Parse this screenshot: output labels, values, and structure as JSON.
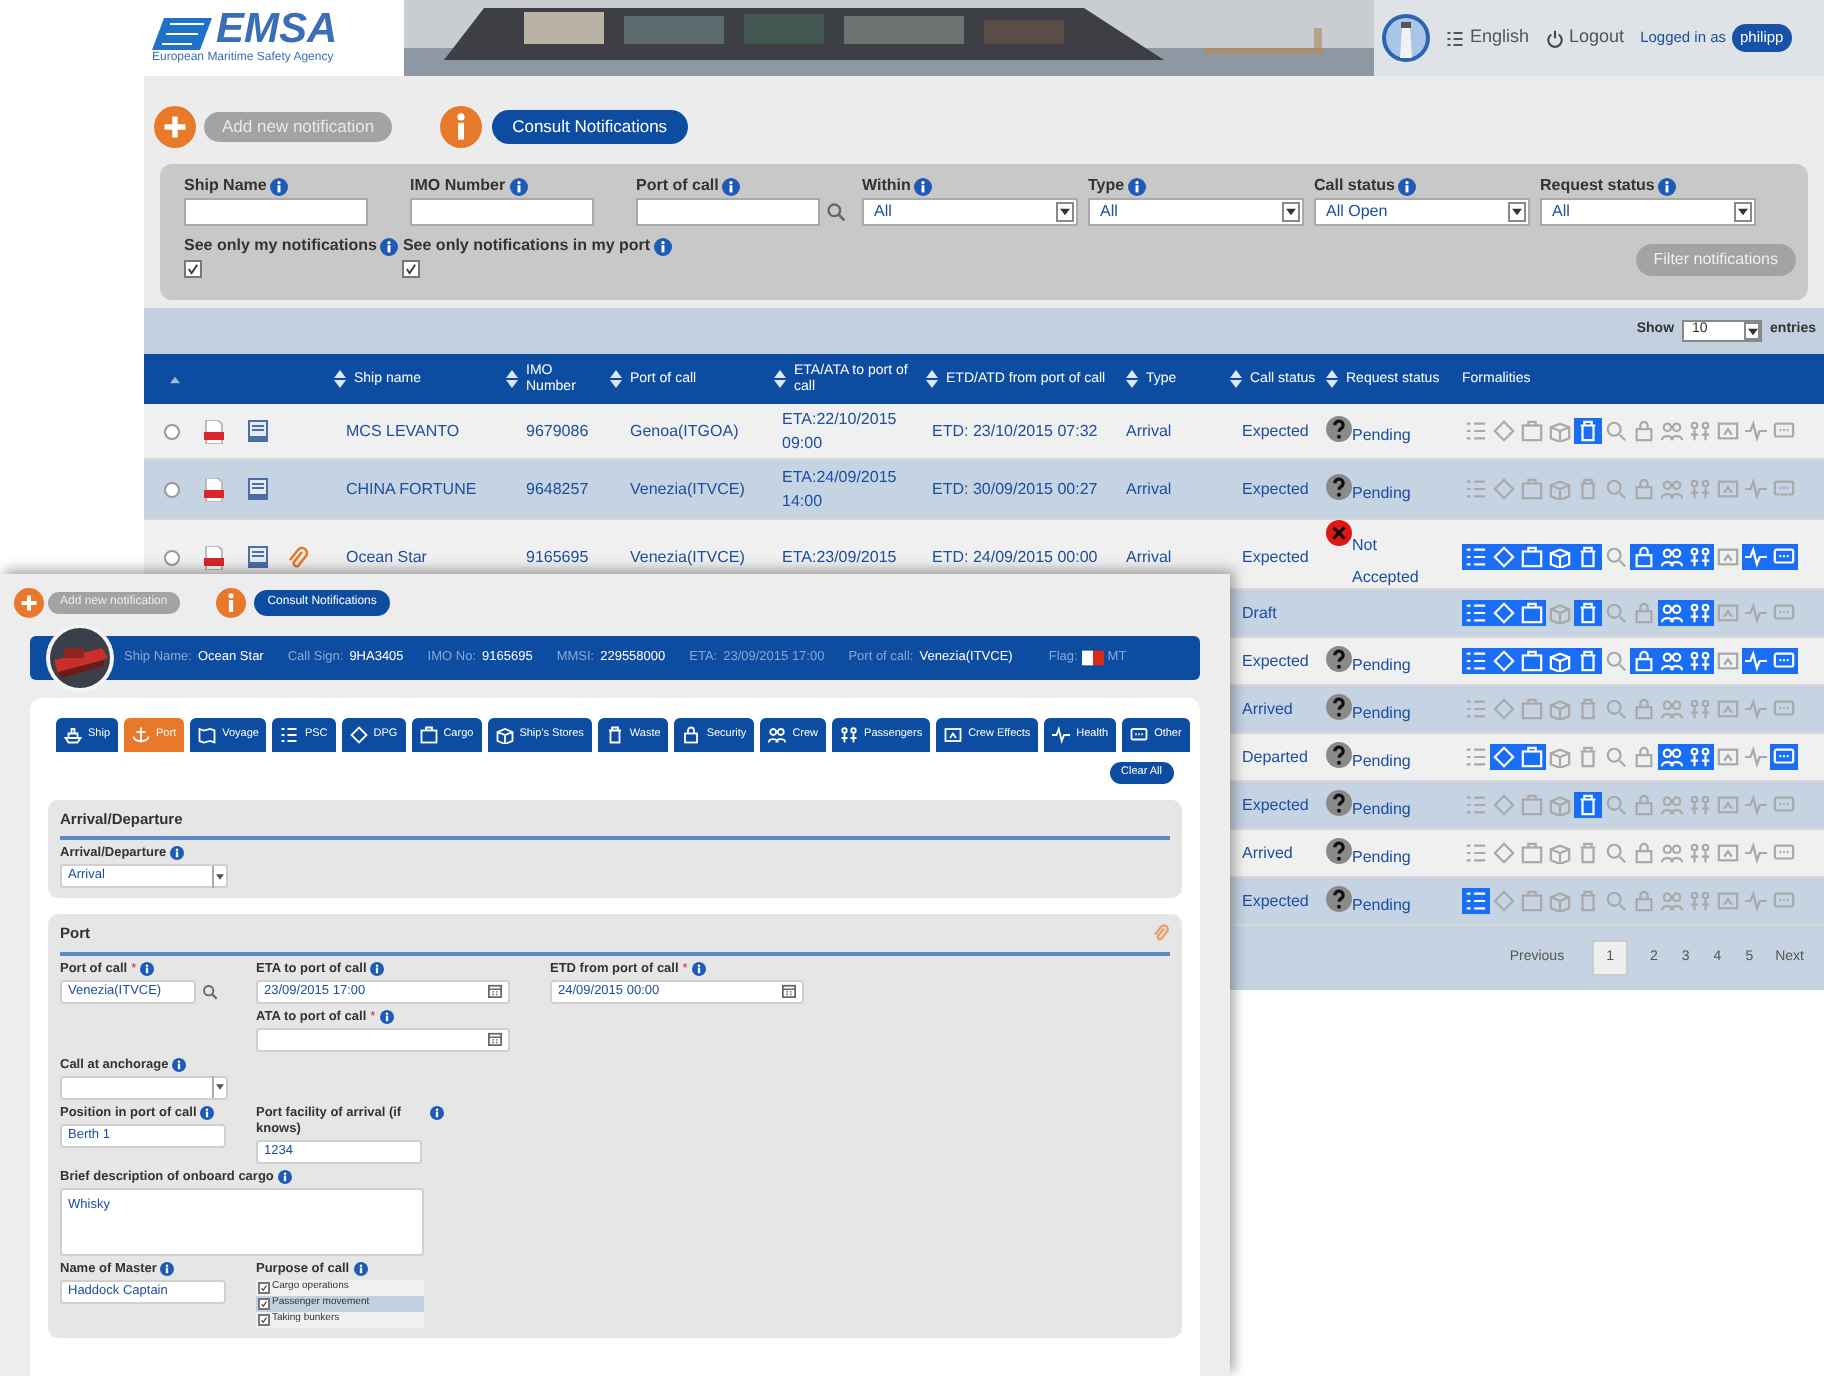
{
  "header": {
    "logo": "EMSA",
    "agency": "European Maritime Safety Agency",
    "language": "English",
    "logout": "Logout",
    "logged_in_label": "Logged in as",
    "user": "philipp"
  },
  "actions": {
    "add": "Add new notification",
    "consult": "Consult Notifications"
  },
  "filters": {
    "fields": [
      {
        "label": "Ship Name",
        "kind": "text"
      },
      {
        "label": "IMO Number",
        "kind": "text"
      },
      {
        "label": "Port of call",
        "kind": "search"
      },
      {
        "label": "Within",
        "kind": "select",
        "value": "All"
      },
      {
        "label": "Type",
        "kind": "select",
        "value": "All"
      },
      {
        "label": "Call status",
        "kind": "select",
        "value": "All Open"
      },
      {
        "label": "Request status",
        "kind": "select",
        "value": "All"
      }
    ],
    "checkboxes": [
      {
        "label": "See only my notifications",
        "checked": true
      },
      {
        "label": "See only notifications in my port",
        "checked": true
      }
    ],
    "button": "Filter notifications"
  },
  "table": {
    "show_label": "Show",
    "page_size": "10",
    "entries_label": "entries",
    "columns": [
      "Ship name",
      "IMO Number",
      "Port of call",
      "ETA/ATA to port of call",
      "ETD/ATD from port of call",
      "Type",
      "Call status",
      "Request status",
      "Formalities"
    ],
    "rows": [
      {
        "selected": false,
        "attachment": false,
        "ship_name": "MCS LEVANTO",
        "imo": "9679086",
        "port": "Genoa(ITGOA)",
        "eta": "ETA:22/10/2015 09:00",
        "etd": "ETD: 23/10/2015 07:32",
        "type": "Arrival",
        "call_status": "Expected",
        "request_status": {
          "kind": "pending",
          "label": "Pending"
        },
        "formalities": [
          false,
          false,
          false,
          false,
          true,
          false,
          false,
          false,
          false,
          false,
          false,
          false
        ]
      },
      {
        "selected": false,
        "attachment": false,
        "ship_name": "CHINA FORTUNE",
        "imo": "9648257",
        "port": "Venezia(ITVCE)",
        "eta": "ETA:24/09/2015 14:00",
        "etd": "ETD: 30/09/2015 00:27",
        "type": "Arrival",
        "call_status": "Expected",
        "request_status": {
          "kind": "pending",
          "label": "Pending"
        },
        "formalities": [
          false,
          false,
          false,
          false,
          false,
          false,
          false,
          false,
          false,
          false,
          false,
          false
        ]
      },
      {
        "selected": false,
        "attachment": true,
        "ship_name": "Ocean Star",
        "imo": "9165695",
        "port": "Venezia(ITVCE)",
        "eta": "ETA:23/09/2015",
        "etd": "ETD: 24/09/2015 00:00",
        "type": "Arrival",
        "call_status": "Expected",
        "request_status": {
          "kind": "rejected",
          "label": "Not Accepted"
        },
        "formalities": [
          true,
          true,
          true,
          true,
          true,
          false,
          true,
          true,
          true,
          false,
          true,
          true
        ]
      },
      {
        "call_status": "Draft",
        "formalities": [
          true,
          true,
          true,
          false,
          true,
          false,
          false,
          true,
          true,
          false,
          false,
          false
        ]
      },
      {
        "call_status": "Expected",
        "request_status": {
          "kind": "pending",
          "label": "Pending"
        },
        "formalities": [
          true,
          true,
          true,
          true,
          true,
          false,
          true,
          true,
          true,
          false,
          true,
          true
        ]
      },
      {
        "call_status": "Arrived",
        "request_status": {
          "kind": "pending",
          "label": "Pending"
        },
        "formalities": [
          false,
          false,
          false,
          false,
          false,
          false,
          false,
          false,
          false,
          false,
          false,
          false
        ]
      },
      {
        "call_status": "Departed",
        "request_status": {
          "kind": "pending",
          "label": "Pending"
        },
        "formalities": [
          false,
          true,
          true,
          false,
          false,
          false,
          false,
          true,
          true,
          false,
          false,
          true
        ]
      },
      {
        "call_status": "Expected",
        "request_status": {
          "kind": "pending",
          "label": "Pending"
        },
        "formalities": [
          false,
          false,
          false,
          false,
          true,
          false,
          false,
          false,
          false,
          false,
          false,
          false
        ]
      },
      {
        "call_status": "Arrived",
        "request_status": {
          "kind": "pending",
          "label": "Pending"
        },
        "formalities": [
          false,
          false,
          false,
          false,
          false,
          false,
          false,
          false,
          false,
          false,
          false,
          false
        ]
      },
      {
        "call_status": "Expected",
        "request_status": {
          "kind": "pending",
          "label": "Pending"
        },
        "formalities": [
          true,
          false,
          false,
          false,
          false,
          false,
          false,
          false,
          false,
          false,
          false,
          false
        ]
      }
    ],
    "pagination": {
      "previous": "Previous",
      "pages": [
        {
          "label": "1",
          "selected": true
        },
        {
          "label": "2",
          "selected": false
        },
        {
          "label": "3",
          "selected": false
        },
        {
          "label": "4",
          "selected": false
        },
        {
          "label": "5",
          "selected": false
        }
      ],
      "next": "Next"
    }
  },
  "form": {
    "actions": {
      "add": "Add new notification",
      "consult": "Consult Notifications"
    },
    "ship_bar": {
      "items": [
        {
          "label": "Ship Name:",
          "value": "Ocean Star",
          "muted": false
        },
        {
          "label": "Call Sign:",
          "value": "9HA3405",
          "muted": false
        },
        {
          "label": "IMO No:",
          "value": "9165695",
          "muted": false
        },
        {
          "label": "MMSI:",
          "value": "229558000",
          "muted": false
        },
        {
          "label": "ETA:",
          "value": "23/09/2015 17:00",
          "muted": true
        },
        {
          "label": "Port of call:",
          "value": "Venezia(ITVCE)",
          "muted": false
        }
      ],
      "flag_label": "Flag:",
      "flag_code": "MT"
    },
    "tabs": [
      {
        "label": "Ship",
        "selected": false
      },
      {
        "label": "Port",
        "selected": true
      },
      {
        "label": "Voyage",
        "selected": false
      },
      {
        "label": "PSC",
        "selected": false
      },
      {
        "label": "DPG",
        "selected": false
      },
      {
        "label": "Cargo",
        "selected": false
      },
      {
        "label": "Ship's Stores",
        "selected": false
      },
      {
        "label": "Waste",
        "selected": false
      },
      {
        "label": "Security",
        "selected": false
      },
      {
        "label": "Crew",
        "selected": false
      },
      {
        "label": "Passengers",
        "selected": false
      },
      {
        "label": "Crew Effects",
        "selected": false
      },
      {
        "label": "Health",
        "selected": false
      },
      {
        "label": "Other",
        "selected": false
      }
    ],
    "clear_all": "Clear All",
    "sections": [
      {
        "title": "Arrival/Departure",
        "attachment": false,
        "rows": [
          [
            {
              "kind": "select",
              "label": "Arrival/Departure",
              "value": "Arrival"
            }
          ]
        ]
      },
      {
        "title": "Port",
        "attachment": true,
        "rows": [
          [
            {
              "kind": "search",
              "label": "Port of call",
              "required_mark": "*",
              "value": "Venezia(ITVCE)"
            },
            {
              "kind": "stack",
              "fields": [
                {
                  "kind": "date",
                  "label": "ETA to port of call",
                  "value": "23/09/2015 17:00"
                },
                {
                  "kind": "date",
                  "label": "ATA to port of call",
                  "required_mark": "*"
                }
              ]
            },
            {
              "kind": "date",
              "label": "ETD from port of call",
              "required_mark": "*",
              "value": "24/09/2015 00:00"
            }
          ],
          [
            {
              "kind": "select",
              "label": "Call at anchorage"
            }
          ],
          [
            {
              "kind": "text",
              "label": "Position in port of call",
              "value": "Berth 1"
            },
            {
              "kind": "text",
              "label": "Port facility of arrival (if knows)",
              "value": "1234"
            }
          ],
          [
            {
              "kind": "textarea",
              "label": "Brief description of onboard cargo",
              "value": "Whisky"
            }
          ],
          [
            {
              "kind": "text",
              "label": "Name of Master",
              "value": "Haddock Captain"
            },
            {
              "kind": "checklist",
              "label": "Purpose of call",
              "items": [
                {
                  "label": "Cargo operations",
                  "checked": true,
                  "selected": false
                },
                {
                  "label": "Passenger movement",
                  "checked": true,
                  "selected": true
                },
                {
                  "label": "Taking bunkers",
                  "checked": true,
                  "selected": false
                }
              ]
            }
          ]
        ]
      }
    ]
  }
}
